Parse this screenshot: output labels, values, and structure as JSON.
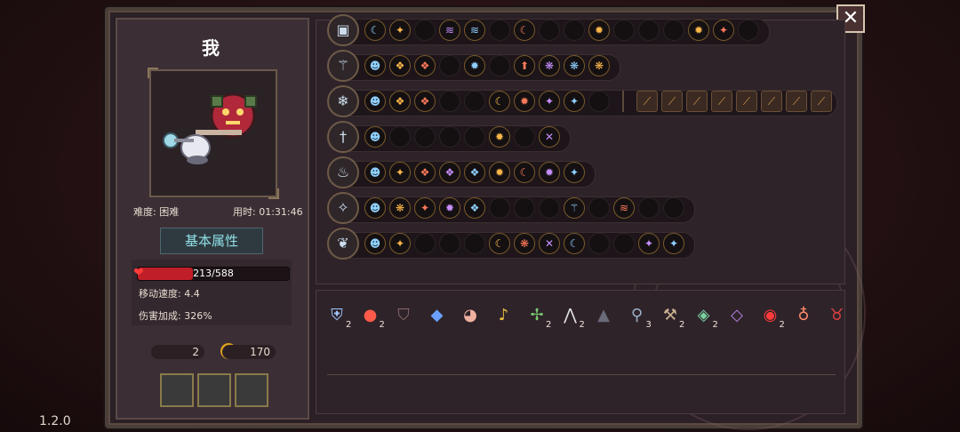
{
  "player": {
    "name": "我",
    "difficulty": "难度: 困难",
    "time": "用时: 01:31:46"
  },
  "section_title": "基本属性",
  "stats": {
    "hp": "213/588",
    "hp_fraction": 0.362,
    "move_speed": "移动速度: 4.4",
    "damage_bonus": "伤害加成: 326%"
  },
  "currency": {
    "keys": "2",
    "coins": "170"
  },
  "version": "1.2.0",
  "close_label": "✕",
  "weapons": [
    {
      "icon": "chest-icon",
      "glyph": "▣",
      "chips": [
        "☾",
        "✦",
        "",
        "≋",
        "≋",
        "",
        "☾",
        "",
        "",
        "✹",
        "",
        "",
        "",
        "✹",
        "✦",
        ""
      ]
    },
    {
      "icon": "sceptre-icon",
      "glyph": "⚚",
      "chips": [
        "☻",
        "❖",
        "❖",
        "",
        "✹",
        "",
        "⬆",
        "❋",
        "❋",
        "❋"
      ]
    },
    {
      "icon": "ice-staff-icon",
      "glyph": "❄",
      "chips": [
        "☻",
        "❖",
        "❖",
        "",
        "",
        "☾",
        "✹",
        "✦",
        "✦",
        ""
      ],
      "extras": 8
    },
    {
      "icon": "dagger-icon",
      "glyph": "†",
      "chips": [
        "☻",
        "",
        "",
        "",
        "",
        "✹",
        "",
        "✕"
      ]
    },
    {
      "icon": "fire-staff-icon",
      "glyph": "♨",
      "chips": [
        "☻",
        "✦",
        "❖",
        "❖",
        "❖",
        "✹",
        "☾",
        "✹",
        "✦"
      ]
    },
    {
      "icon": "wand-icon",
      "glyph": "✧",
      "chips": [
        "☻",
        "❋",
        "✦",
        "✹",
        "❖",
        "",
        "",
        "",
        "⚚",
        "",
        "≋",
        "",
        ""
      ]
    },
    {
      "icon": "nature-staff-icon",
      "glyph": "❦",
      "chips": [
        "☻",
        "✦",
        "",
        "",
        "",
        "☾",
        "❋",
        "✕",
        "☾",
        "",
        "",
        "✦",
        "✦"
      ]
    }
  ],
  "items": [
    {
      "icon": "shield-icon",
      "glyph": "⛨",
      "count": "2"
    },
    {
      "icon": "bomb-icon",
      "glyph": "●",
      "count": "2"
    },
    {
      "icon": "cloak-icon",
      "glyph": "⛉",
      "count": ""
    },
    {
      "icon": "drop-icon",
      "glyph": "◆",
      "count": ""
    },
    {
      "icon": "pig-icon",
      "glyph": "◕",
      "count": ""
    },
    {
      "icon": "bell-icon",
      "glyph": "♪",
      "count": ""
    },
    {
      "icon": "dragonfly-icon",
      "glyph": "✢",
      "count": "2"
    },
    {
      "icon": "teeth-icon",
      "glyph": "⋀",
      "count": "2"
    },
    {
      "icon": "hood-icon",
      "glyph": "▲",
      "count": ""
    },
    {
      "icon": "magnifier-icon",
      "glyph": "⚲",
      "count": "3"
    },
    {
      "icon": "hammer-icon",
      "glyph": "⚒",
      "count": "2"
    },
    {
      "icon": "gem-icon",
      "glyph": "◈",
      "count": "2"
    },
    {
      "icon": "crystal-icon",
      "glyph": "◇",
      "count": ""
    },
    {
      "icon": "red-eye-icon",
      "glyph": "◉",
      "count": "2"
    },
    {
      "icon": "potion-icon",
      "glyph": "♁",
      "count": ""
    },
    {
      "icon": "demon-mask-icon",
      "glyph": "♉",
      "count": ""
    }
  ]
}
